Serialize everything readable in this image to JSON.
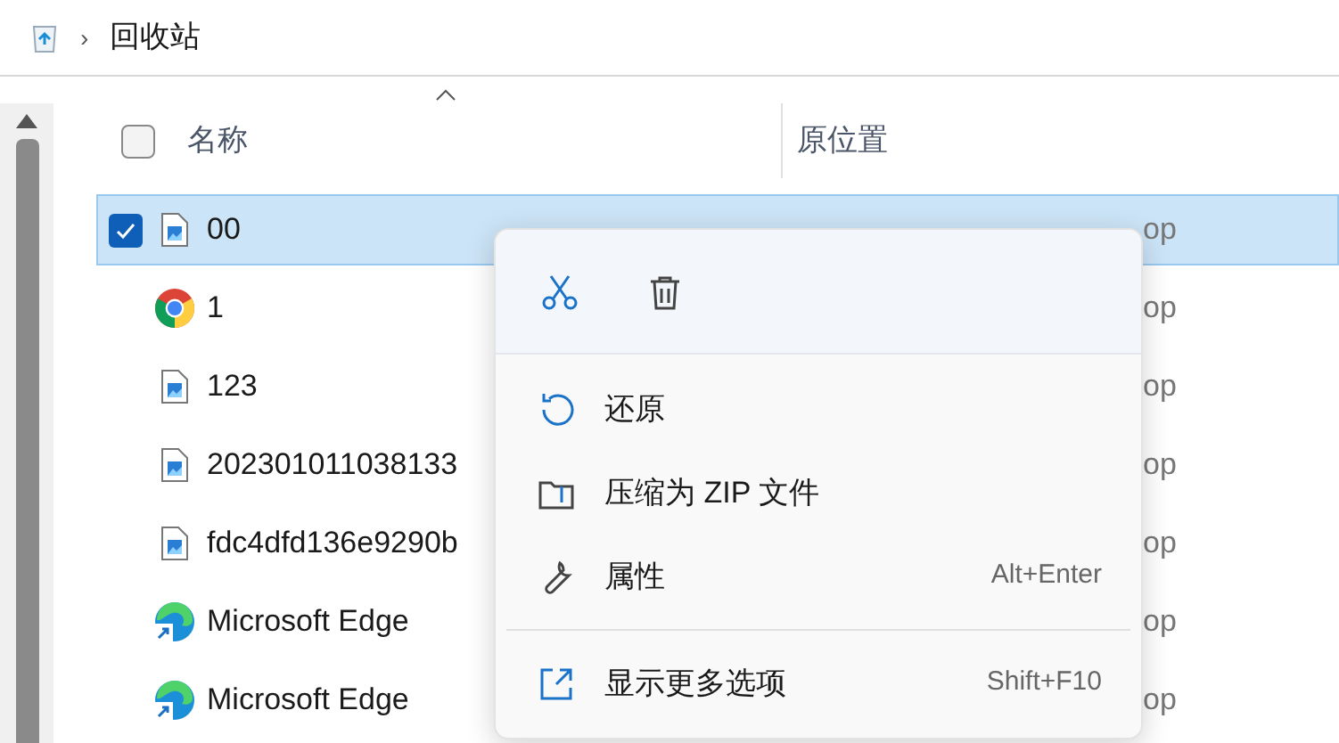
{
  "breadcrumb": {
    "separator": "›",
    "items": [
      "回收站"
    ]
  },
  "table": {
    "columns": [
      {
        "label": "名称",
        "sorted": true
      },
      {
        "label": "原位置"
      }
    ],
    "select_all": {
      "checked": false
    },
    "rows": [
      {
        "name": "00",
        "kind": "image",
        "selected": true,
        "location": "op"
      },
      {
        "name": "1",
        "kind": "chrome",
        "selected": false,
        "location": "op"
      },
      {
        "name": "123",
        "kind": "image",
        "selected": false,
        "location": "op"
      },
      {
        "name": "202301011038133",
        "kind": "image",
        "selected": false,
        "location": "op"
      },
      {
        "name": "fdc4dfd136e9290b",
        "kind": "image",
        "selected": false,
        "location": "op"
      },
      {
        "name": "Microsoft Edge",
        "kind": "edge",
        "selected": false,
        "location": "op"
      },
      {
        "name": "Microsoft Edge",
        "kind": "edge",
        "selected": false,
        "location": "op"
      }
    ]
  },
  "context_menu": {
    "toolbar": [
      {
        "kind": "cut"
      },
      {
        "kind": "delete"
      }
    ],
    "items": [
      {
        "kind": "restore",
        "label": "还原"
      },
      {
        "kind": "zip",
        "label": "压缩为 ZIP 文件"
      },
      {
        "kind": "properties",
        "label": "属性",
        "shortcut": "Alt+Enter"
      },
      {
        "kind": "separator"
      },
      {
        "kind": "more",
        "label": "显示更多选项",
        "shortcut": "Shift+F10"
      }
    ]
  }
}
